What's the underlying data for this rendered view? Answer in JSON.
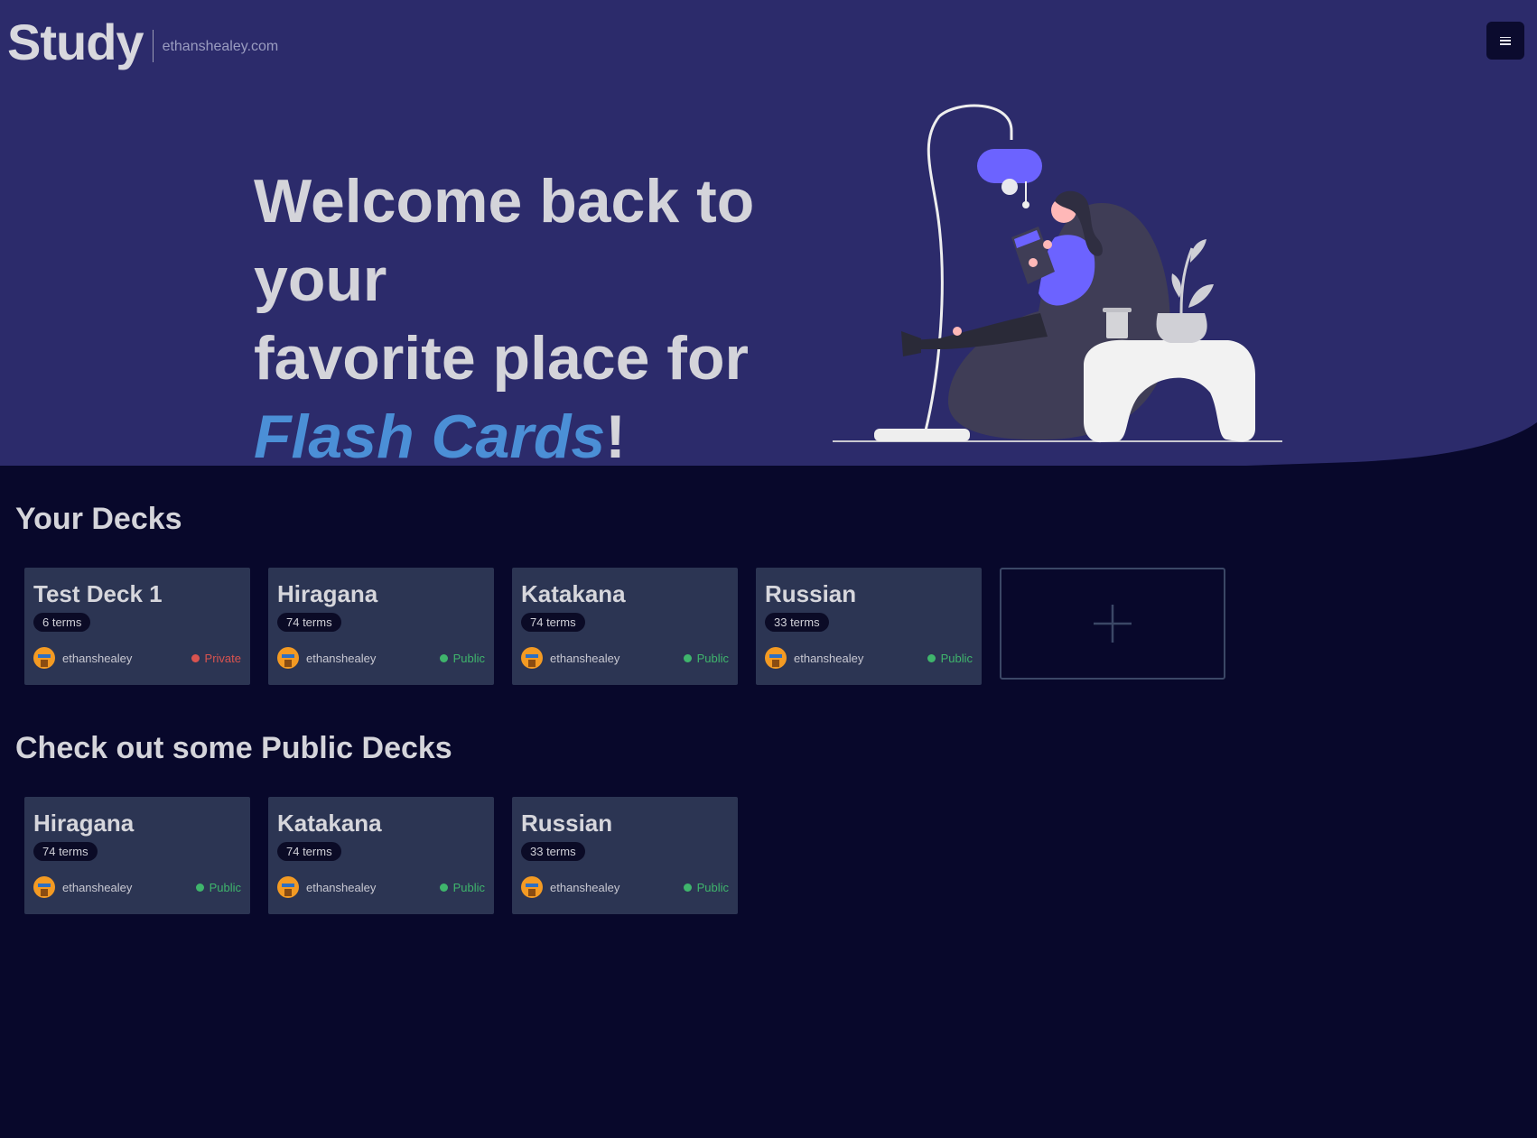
{
  "brand": {
    "title": "Study",
    "domain": "ethanshealey.com"
  },
  "menu": {
    "icon": "hamburger-menu-icon"
  },
  "hero": {
    "line1": "Welcome back to your",
    "line2": "favorite place for",
    "highlight": "Flash Cards",
    "suffix": "!",
    "highlight_color": "#4b8fd6",
    "illustration": "woman-reading-on-beanbag-illustration"
  },
  "your_decks": {
    "title": "Your Decks",
    "cards": [
      {
        "title": "Test Deck 1",
        "terms": "6 terms",
        "owner": "ethanshealey",
        "visibility": "Private",
        "visibility_color": "#d9534f"
      },
      {
        "title": "Hiragana",
        "terms": "74 terms",
        "owner": "ethanshealey",
        "visibility": "Public",
        "visibility_color": "#3fb56c"
      },
      {
        "title": "Katakana",
        "terms": "74 terms",
        "owner": "ethanshealey",
        "visibility": "Public",
        "visibility_color": "#3fb56c"
      },
      {
        "title": "Russian",
        "terms": "33 terms",
        "owner": "ethanshealey",
        "visibility": "Public",
        "visibility_color": "#3fb56c"
      }
    ],
    "add_icon": "plus-icon"
  },
  "public_decks": {
    "title": "Check out some Public Decks",
    "cards": [
      {
        "title": "Hiragana",
        "terms": "74 terms",
        "owner": "ethanshealey",
        "visibility": "Public",
        "visibility_color": "#3fb56c"
      },
      {
        "title": "Katakana",
        "terms": "74 terms",
        "owner": "ethanshealey",
        "visibility": "Public",
        "visibility_color": "#3fb56c"
      },
      {
        "title": "Russian",
        "terms": "33 terms",
        "owner": "ethanshealey",
        "visibility": "Public",
        "visibility_color": "#3fb56c"
      }
    ]
  },
  "colors": {
    "hero_bg": "#2c2b6b",
    "page_bg": "#08082b",
    "card_bg": "#2c3553"
  }
}
